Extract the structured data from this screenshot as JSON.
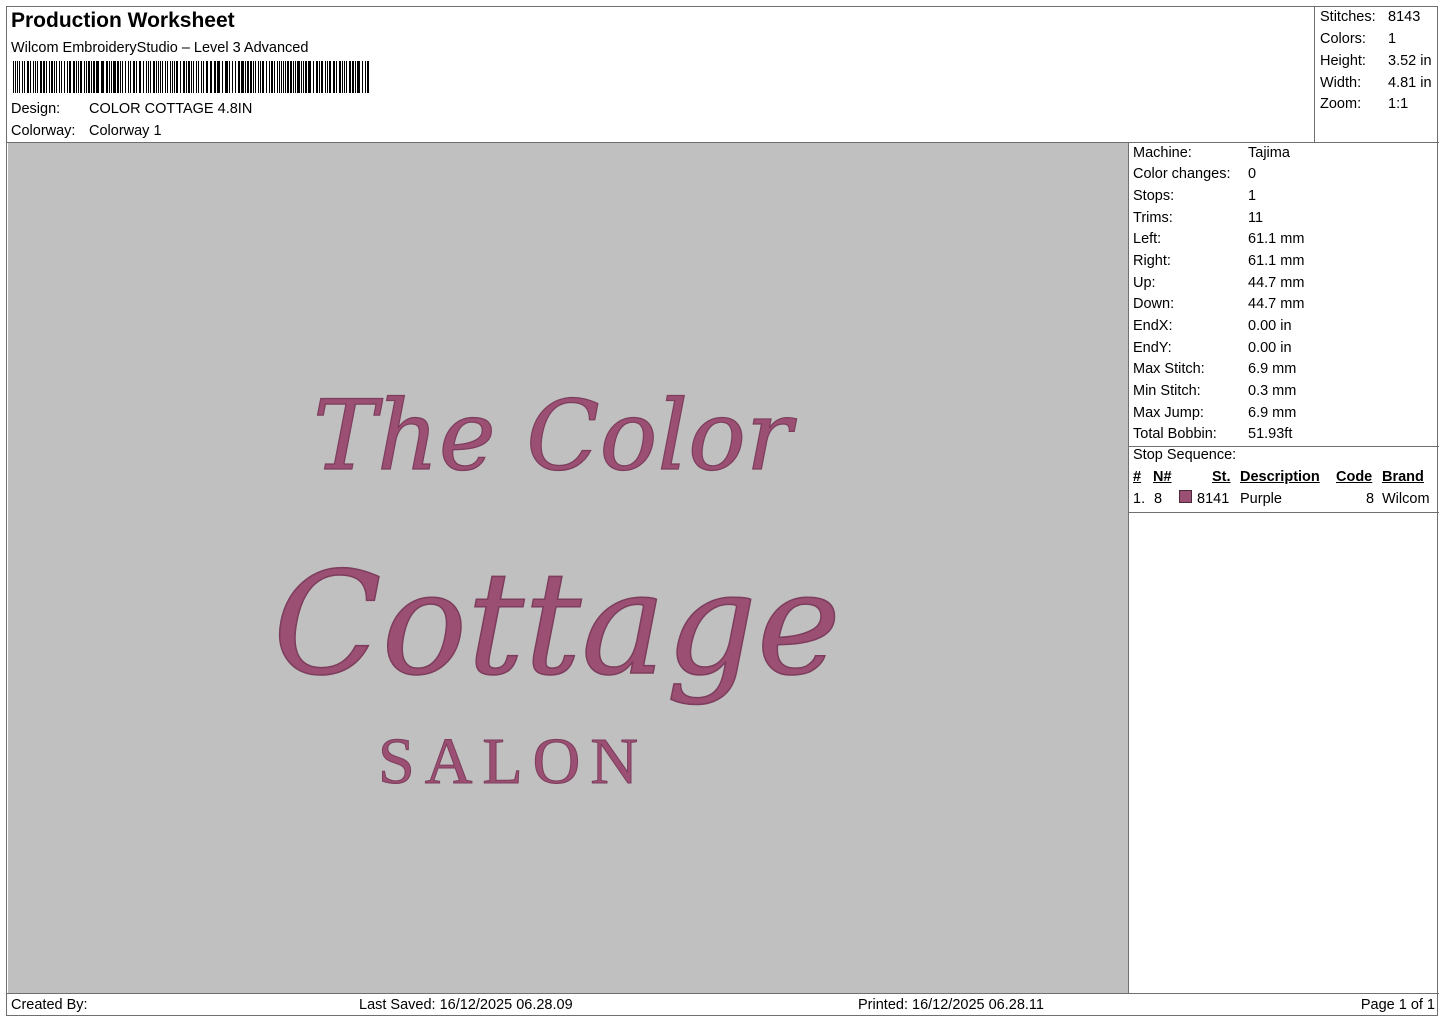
{
  "header": {
    "title": "Production Worksheet",
    "subtitle": "Wilcom EmbroideryStudio – Level 3 Advanced",
    "design_label": "Design:",
    "design_value": "COLOR COTTAGE 4.8IN",
    "colorway_label": "Colorway:",
    "colorway_value": "Colorway 1"
  },
  "summary": [
    {
      "label": "Stitches:",
      "value": "8143"
    },
    {
      "label": "Colors:",
      "value": "1"
    },
    {
      "label": "Height:",
      "value": "3.52 in"
    },
    {
      "label": "Width:",
      "value": "4.81 in"
    },
    {
      "label": "Zoom:",
      "value": "1:1"
    }
  ],
  "properties": [
    {
      "label": "Machine:",
      "value": "Tajima"
    },
    {
      "label": "Color changes:",
      "value": "0"
    },
    {
      "label": "Stops:",
      "value": "1"
    },
    {
      "label": "Trims:",
      "value": "11"
    },
    {
      "label": "Left:",
      "value": "61.1 mm"
    },
    {
      "label": "Right:",
      "value": "61.1 mm"
    },
    {
      "label": "Up:",
      "value": "44.7 mm"
    },
    {
      "label": "Down:",
      "value": "44.7 mm"
    },
    {
      "label": "EndX:",
      "value": "0.00 in"
    },
    {
      "label": "EndY:",
      "value": "0.00 in"
    },
    {
      "label": "Max Stitch:",
      "value": "6.9 mm"
    },
    {
      "label": "Min Stitch:",
      "value": "0.3 mm"
    },
    {
      "label": "Max Jump:",
      "value": "6.9 mm"
    },
    {
      "label": "Total Bobbin:",
      "value": "51.93ft"
    }
  ],
  "stop_sequence": {
    "title": "Stop Sequence:",
    "headers": {
      "num": "#",
      "n": "N#",
      "st": "St.",
      "description": "Description",
      "code": "Code",
      "brand": "Brand"
    },
    "rows": [
      {
        "num": "1.",
        "n": "8",
        "swatch_color": "#9a4f73",
        "st": "8141",
        "description": "Purple",
        "code": "8",
        "brand": "Wilcom"
      }
    ]
  },
  "design_preview": {
    "line1": "The Color",
    "line2": "Cottage",
    "line3": "SALON",
    "thread_color": "#9a4f73",
    "background_color": "#c0c0c0"
  },
  "footer": {
    "created_by": "Created By:",
    "last_saved": "Last Saved: 16/12/2025 06.28.09",
    "printed": "Printed: 16/12/2025 06.28.11",
    "page": "Page 1 of 1"
  }
}
